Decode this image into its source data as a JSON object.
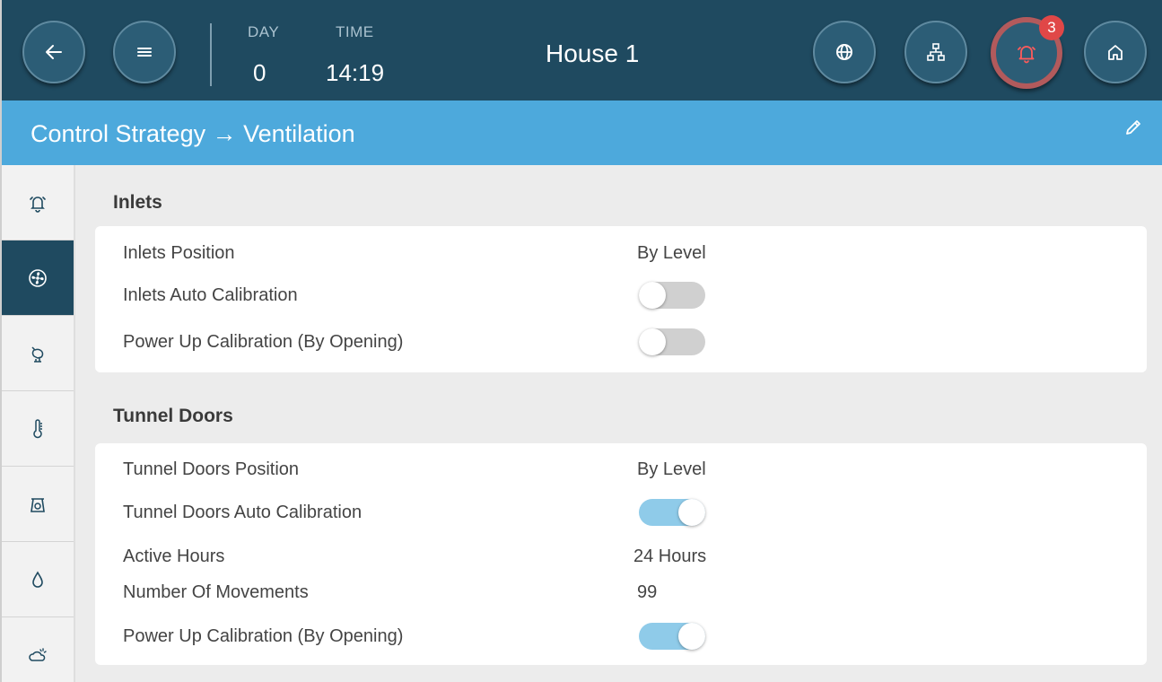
{
  "header": {
    "day_label": "DAY",
    "day_value": "0",
    "time_label": "TIME",
    "time_value": "14:19",
    "house_name": "House 1",
    "alarm_count": "3",
    "icons": [
      "back-icon",
      "menu-icon",
      "globe-icon",
      "network-icon",
      "bell-icon",
      "home-icon"
    ]
  },
  "titlebar": {
    "title": "Control Strategy → Ventilation",
    "edit_icon": "pencil-icon"
  },
  "sidebar": {
    "items": [
      {
        "icon": "alarm-icon",
        "active": false
      },
      {
        "icon": "fan-icon",
        "active": true
      },
      {
        "icon": "bird-icon",
        "active": false
      },
      {
        "icon": "thermometer-icon",
        "active": false
      },
      {
        "icon": "scale-icon",
        "active": false
      },
      {
        "icon": "water-drop-icon",
        "active": false
      },
      {
        "icon": "weather-icon",
        "active": false
      }
    ]
  },
  "sections": {
    "inlets": {
      "title": "Inlets",
      "position_label": "Inlets Position",
      "position_value": "By Level",
      "auto_cal_label": "Inlets Auto Calibration",
      "auto_cal_on": false,
      "power_up_label": "Power Up Calibration (By Opening)",
      "power_up_on": false
    },
    "tunnel_doors": {
      "title": "Tunnel Doors",
      "position_label": "Tunnel Doors Position",
      "position_value": "By Level",
      "auto_cal_label": "Tunnel Doors Auto Calibration",
      "auto_cal_on": true,
      "active_hours_label": "Active Hours",
      "active_hours_value": "24 Hours",
      "movements_label": "Number Of Movements",
      "movements_value": "99",
      "power_up_label": "Power Up Calibration (By Opening)",
      "power_up_on": true
    }
  },
  "colors": {
    "header_bg": "#1f4a60",
    "titlebar_bg": "#4da9dc",
    "toggle_on": "#8fcbe9",
    "toggle_off": "#d0d0d0",
    "alarm_ring": "#b25a5c",
    "badge": "#e04747"
  }
}
